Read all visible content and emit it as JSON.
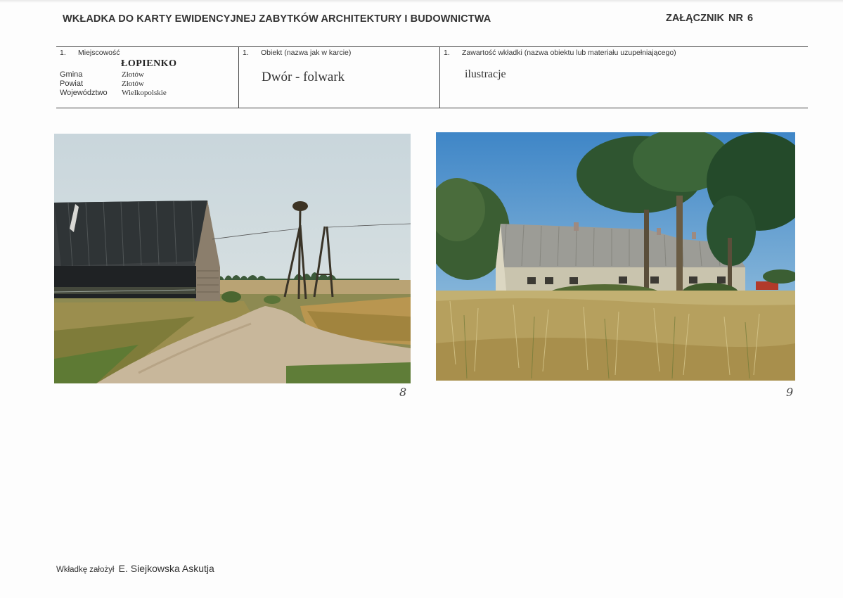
{
  "header": {
    "title": "WKŁADKA DO KARTY EWIDENCYJNEJ ZABYTKÓW ARCHITEKTURY I BUDOWNICTWA",
    "annex": "ZAŁĄCZNIK NR 6"
  },
  "location": {
    "number": "1.",
    "label": "Miejscowość",
    "town": "ŁOPIENKO",
    "gmina_label": "Gmina",
    "gmina": "Złotów",
    "powiat_label": "Powiat",
    "powiat": "Złotów",
    "wojewodztwo_label": "Województwo",
    "wojewodztwo": "Wielkopolskie"
  },
  "object": {
    "number": "1.",
    "label": "Obiekt (nazwa jak w karcie)",
    "name": "Dwór - folwark"
  },
  "contents": {
    "number": "1.",
    "label": "Zawartość wkładki (nazwa obiektu lub materiału uzupełniającego)",
    "value": "ilustracje"
  },
  "photos": [
    {
      "number": "8"
    },
    {
      "number": "9"
    }
  ],
  "footer": {
    "label": "Wkładkę założył",
    "author": "E. Siejkowska Askutja"
  }
}
